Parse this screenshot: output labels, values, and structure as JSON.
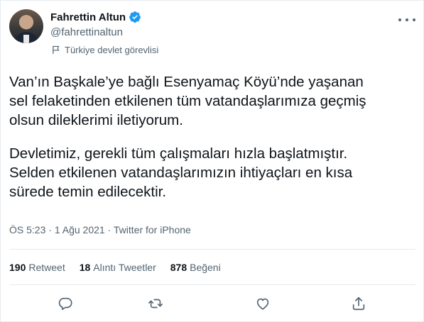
{
  "author": {
    "name": "Fahrettin Altun",
    "handle": "@fahrettinaltun",
    "label": "Türkiye devlet görevlisi"
  },
  "tweet": {
    "lines": [
      "Van’ın Başkale’ye bağlı Esenyamaç Köyü’nde yaşanan",
      "sel felaketinden etkilenen tüm vatandaşlarımıza geçmiş",
      "olsun dileklerimi iletiyorum.",
      "Devletimiz, gerekli tüm çalışmaları hızla başlatmıştır.",
      "Selden etkilenen vatandaşlarımızın ihtiyaçları en kısa",
      "sürede temin edilecektir."
    ]
  },
  "meta": {
    "time": "ÖS 5:23",
    "separator1": " · ",
    "date": "1 Ağu 2021",
    "separator2": " · ",
    "source": "Twitter for iPhone"
  },
  "stats": {
    "retweets_count": "190",
    "retweets_label": "Retweet",
    "quotes_count": "18",
    "quotes_label": "Alıntı Tweetler",
    "likes_count": "878",
    "likes_label": "Beğeni"
  },
  "colors": {
    "verified": "#1d9bf0",
    "icon_gray": "#536471",
    "divider": "#e6ecf0"
  },
  "icons": {
    "reply": "speech-bubble-icon",
    "retweet": "retweet-arrows-icon",
    "like": "heart-icon",
    "share": "share-upload-icon",
    "more": "more-dots-icon",
    "verified": "verified-badge-icon",
    "government": "flag-icon"
  }
}
